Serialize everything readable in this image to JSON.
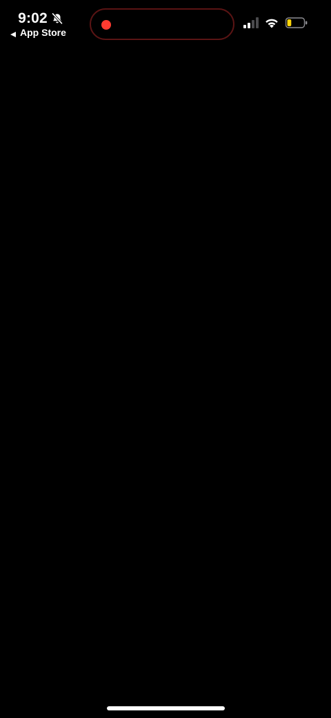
{
  "status_bar": {
    "time": "9:02",
    "back_label": "App Store",
    "icons": {
      "silent": "bell-slash-icon",
      "back": "back-triangle-icon",
      "signal": "cellular-signal-icon",
      "wifi": "wifi-icon",
      "battery": "battery-icon"
    },
    "signal_bars_active": 2,
    "signal_bars_total": 4,
    "battery_level": 0.25
  },
  "dynamic_island": {
    "recording_indicator": "red-dot"
  },
  "colors": {
    "background": "#000000",
    "text": "#ffffff",
    "recording": "#ff3b30",
    "island_border": "#5a1414",
    "battery_fill": "#ffd60a"
  }
}
